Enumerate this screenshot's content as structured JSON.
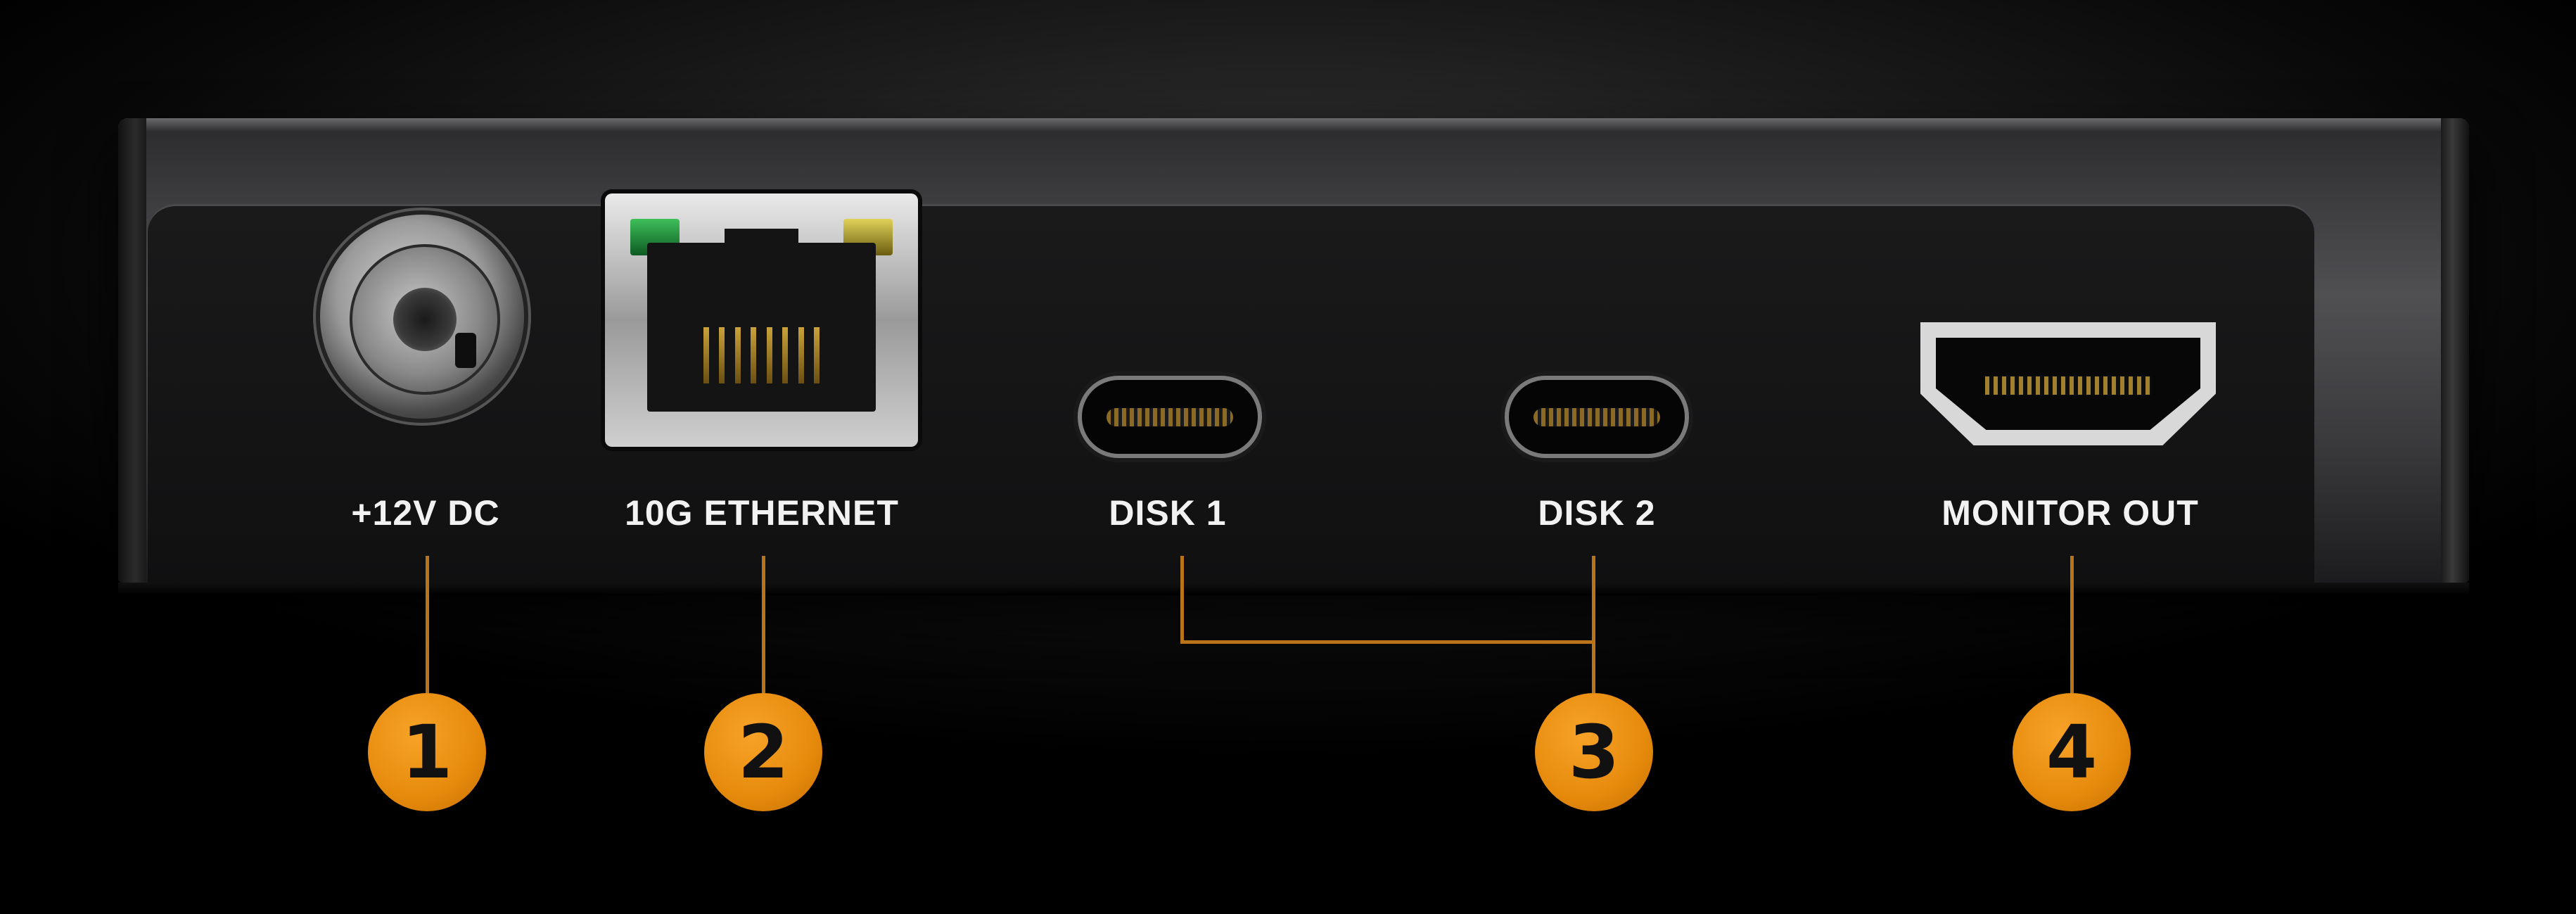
{
  "ports": [
    {
      "id": "power",
      "label": "+12V DC",
      "callout": "1"
    },
    {
      "id": "ethernet",
      "label": "10G ETHERNET",
      "callout": "2"
    },
    {
      "id": "disk1",
      "label": "DISK 1",
      "callout": "3"
    },
    {
      "id": "disk2",
      "label": "DISK 2",
      "callout": "3"
    },
    {
      "id": "monitor",
      "label": "MONITOR OUT",
      "callout": "4"
    }
  ],
  "callouts": [
    "1",
    "2",
    "3",
    "4"
  ],
  "colors": {
    "callout_fill": "#e68a0c",
    "leader_line": "#b87418",
    "label_text": "#f2f2f2",
    "device_body": "#3d3d40",
    "background": "#080808"
  }
}
